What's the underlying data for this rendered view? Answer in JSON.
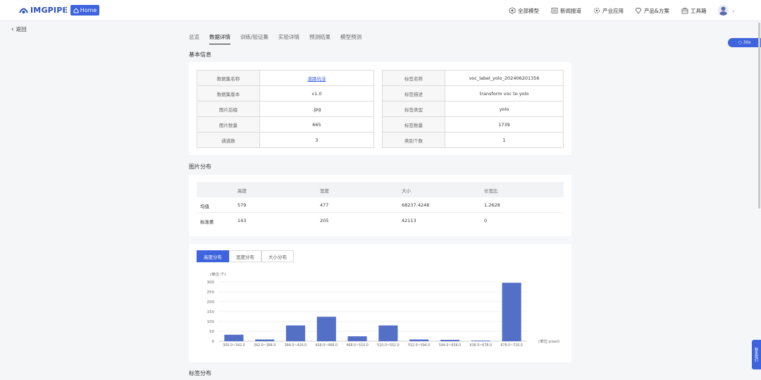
{
  "header": {
    "logo_text": "IMGPIPE",
    "home_label": "Home",
    "nav": [
      {
        "icon": "model-icon",
        "label": "全部模型"
      },
      {
        "icon": "news-icon",
        "label": "新闻报道"
      },
      {
        "icon": "industry-icon",
        "label": "产业应用"
      },
      {
        "icon": "product-icon",
        "label": "产品&方案"
      },
      {
        "icon": "toolbox-icon",
        "label": "工具箱"
      }
    ]
  },
  "back_label": "返回",
  "tabs": [
    {
      "label": "总览",
      "active": false
    },
    {
      "label": "数据详情",
      "active": true
    },
    {
      "label": "训练/验证集",
      "active": false
    },
    {
      "label": "实验详情",
      "active": false
    },
    {
      "label": "预测结果",
      "active": false
    },
    {
      "label": "模型预测",
      "active": false
    }
  ],
  "basic_info": {
    "title": "基本信息",
    "left": [
      {
        "key": "数据集名称",
        "value": "道路坑洼",
        "link": true
      },
      {
        "key": "数据集版本",
        "value": "v1.0"
      },
      {
        "key": "图片后缀",
        "value": ".jpg"
      },
      {
        "key": "图片数量",
        "value": "665"
      },
      {
        "key": "通道数",
        "value": "3"
      }
    ],
    "right": [
      {
        "key": "标签名称",
        "value": "voc_label_yolo_202406201356"
      },
      {
        "key": "标签描述",
        "value": "transform voc to yolo"
      },
      {
        "key": "标签类型",
        "value": "yolo"
      },
      {
        "key": "标签数量",
        "value": "1739"
      },
      {
        "key": "类别个数",
        "value": "1"
      }
    ]
  },
  "image_dist": {
    "title": "图片分布",
    "columns": [
      "",
      "高度",
      "宽度",
      "大小",
      "长宽比"
    ],
    "rows": [
      [
        "均值",
        "579",
        "477",
        "68237.4248",
        "1.2628"
      ],
      [
        "标准差",
        "143",
        "205",
        "42113",
        "0"
      ]
    ]
  },
  "chart_tabs": [
    {
      "label": "高度分布",
      "active": true
    },
    {
      "label": "宽度分布",
      "active": false
    },
    {
      "label": "大小分布",
      "active": false
    }
  ],
  "chart_data": {
    "type": "bar",
    "categories": [
      "300.0~342.0",
      "342.0~384.0",
      "384.0~426.0",
      "426.0~468.0",
      "468.0~510.0",
      "510.0~552.0",
      "552.0~594.0",
      "594.0~636.0",
      "636.0~678.0",
      "678.0~720.0"
    ],
    "values": [
      33,
      9,
      80,
      124,
      25,
      80,
      9,
      7,
      3,
      296
    ],
    "ylabel": "(单位:个)",
    "xlabel": "(单位:pixel)",
    "yticks": [
      0,
      50,
      100,
      150,
      200,
      250,
      300
    ],
    "ylim": [
      0,
      300
    ],
    "grid": true,
    "color": "#5470c6"
  },
  "label_dist_title": "标签分布",
  "float_pill": "30s",
  "float_side": "联系我们"
}
